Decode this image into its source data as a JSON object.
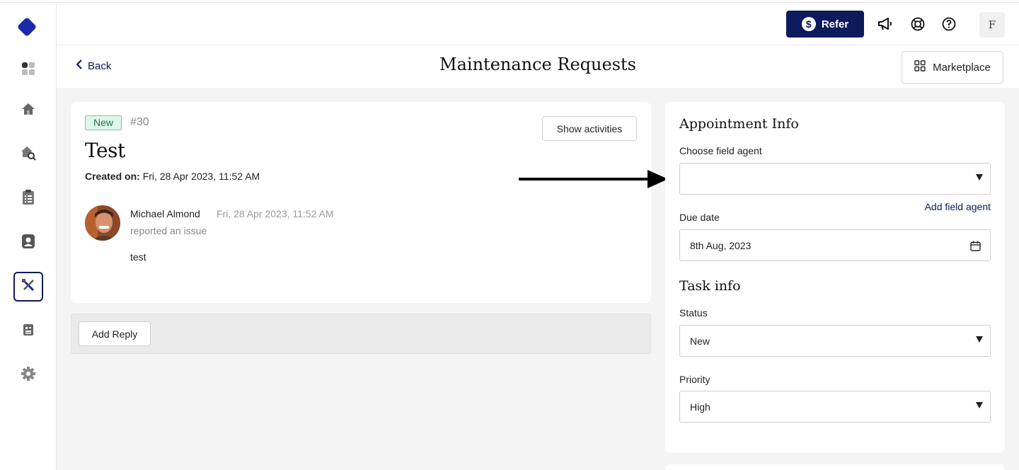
{
  "sidebar": {
    "logo_name": "app-logo",
    "items": [
      {
        "name": "dashboard",
        "icon": "dashboard-icon"
      },
      {
        "name": "properties",
        "icon": "home-icon"
      },
      {
        "name": "property-search",
        "icon": "home-search-icon"
      },
      {
        "name": "leases",
        "icon": "document-list-icon"
      },
      {
        "name": "tenants",
        "icon": "contact-icon"
      },
      {
        "name": "maintenance",
        "icon": "tools-icon",
        "active": true
      },
      {
        "name": "reports",
        "icon": "report-icon"
      },
      {
        "name": "settings",
        "icon": "gear-icon"
      }
    ]
  },
  "topbar": {
    "refer_label": "Refer",
    "refer_icon": "dollar-icon",
    "user_initial": "F"
  },
  "header": {
    "back_label": "Back",
    "title": "Maintenance Requests",
    "marketplace_label": "Marketplace"
  },
  "request": {
    "status_badge": "New",
    "number": "#30",
    "title": "Test",
    "created_label": "Created on:",
    "created_value": "Fri, 28 Apr 2023, 11:52 AM",
    "show_activities_label": "Show activities",
    "comment": {
      "author": "Michael Almond",
      "time": "Fri, 28 Apr 2023, 11:52 AM",
      "action": "reported an issue",
      "body": "test"
    },
    "add_reply_label": "Add Reply"
  },
  "appointment": {
    "heading": "Appointment Info",
    "agent_label": "Choose field agent",
    "agent_value": "",
    "add_agent_label": "Add field agent",
    "due_label": "Due date",
    "due_value": "8th Aug, 2023"
  },
  "task": {
    "heading": "Task info",
    "status_label": "Status",
    "status_value": "New",
    "priority_label": "Priority",
    "priority_value": "High"
  },
  "colors": {
    "brand": "#0d1a5c",
    "badge_bg": "#e1f6ea",
    "badge_text": "#1a7a4a"
  }
}
